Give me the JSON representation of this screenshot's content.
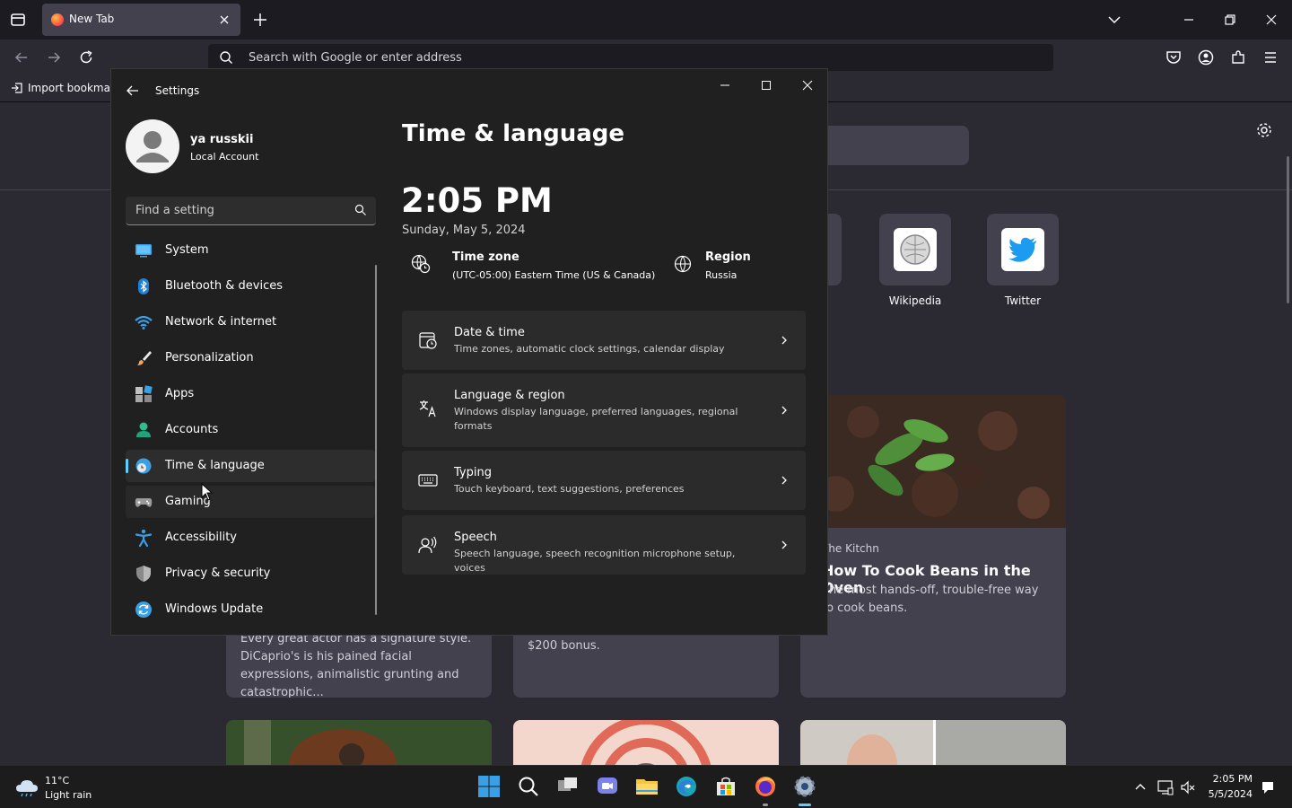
{
  "browser": {
    "tab_title": "New Tab",
    "url_placeholder": "Search with Google or enter address",
    "bookmark_item": "Import bookmarks...",
    "shortcuts": [
      {
        "label": "Wikipedia"
      },
      {
        "label": "Twitter"
      }
    ],
    "cards": {
      "kitchn": {
        "source": "The Kitchn",
        "headline": "How To Cook Beans in the Oven",
        "excerpt": "The most hands-off, trouble-free way to cook beans."
      },
      "dicaprio": {
        "excerpt": "Every great actor has a signature style. DiCaprio's is his pained facial expressions, animalistic grunting and catastrophic..."
      },
      "bonus": {
        "excerpt": "$200 bonus."
      }
    }
  },
  "settings": {
    "window_title": "Settings",
    "user": {
      "name": "ya russkii",
      "account_type": "Local Account"
    },
    "search_placeholder": "Find a setting",
    "nav": [
      {
        "label": "System",
        "icon": "system-icon"
      },
      {
        "label": "Bluetooth & devices",
        "icon": "bluetooth-icon"
      },
      {
        "label": "Network & internet",
        "icon": "wifi-icon"
      },
      {
        "label": "Personalization",
        "icon": "brush-icon"
      },
      {
        "label": "Apps",
        "icon": "apps-icon"
      },
      {
        "label": "Accounts",
        "icon": "accounts-icon"
      },
      {
        "label": "Time & language",
        "icon": "time-language-icon",
        "selected": true
      },
      {
        "label": "Gaming",
        "icon": "gamepad-icon"
      },
      {
        "label": "Accessibility",
        "icon": "accessibility-icon"
      },
      {
        "label": "Privacy & security",
        "icon": "shield-icon"
      },
      {
        "label": "Windows Update",
        "icon": "update-icon"
      }
    ],
    "page": {
      "title": "Time & language",
      "time": "2:05 PM",
      "date": "Sunday, May 5, 2024",
      "timezone": {
        "label": "Time zone",
        "value": "(UTC-05:00) Eastern Time (US & Canada)"
      },
      "region": {
        "label": "Region",
        "value": "Russia"
      },
      "rows": [
        {
          "title": "Date & time",
          "desc": "Time zones, automatic clock settings, calendar display"
        },
        {
          "title": "Language & region",
          "desc": "Windows display language, preferred languages, regional formats"
        },
        {
          "title": "Typing",
          "desc": "Touch keyboard, text suggestions, preferences"
        },
        {
          "title": "Speech",
          "desc": "Speech language, speech recognition microphone setup, voices"
        }
      ]
    }
  },
  "taskbar": {
    "weather_temp": "11°C",
    "weather_cond": "Light rain",
    "time": "2:05 PM",
    "date": "5/5/2024"
  },
  "colors": {
    "accent": "#60cdff",
    "settings_bg": "#202020",
    "card_bg": "#2b2b2b",
    "firefox_bg": "#2b2a33"
  }
}
